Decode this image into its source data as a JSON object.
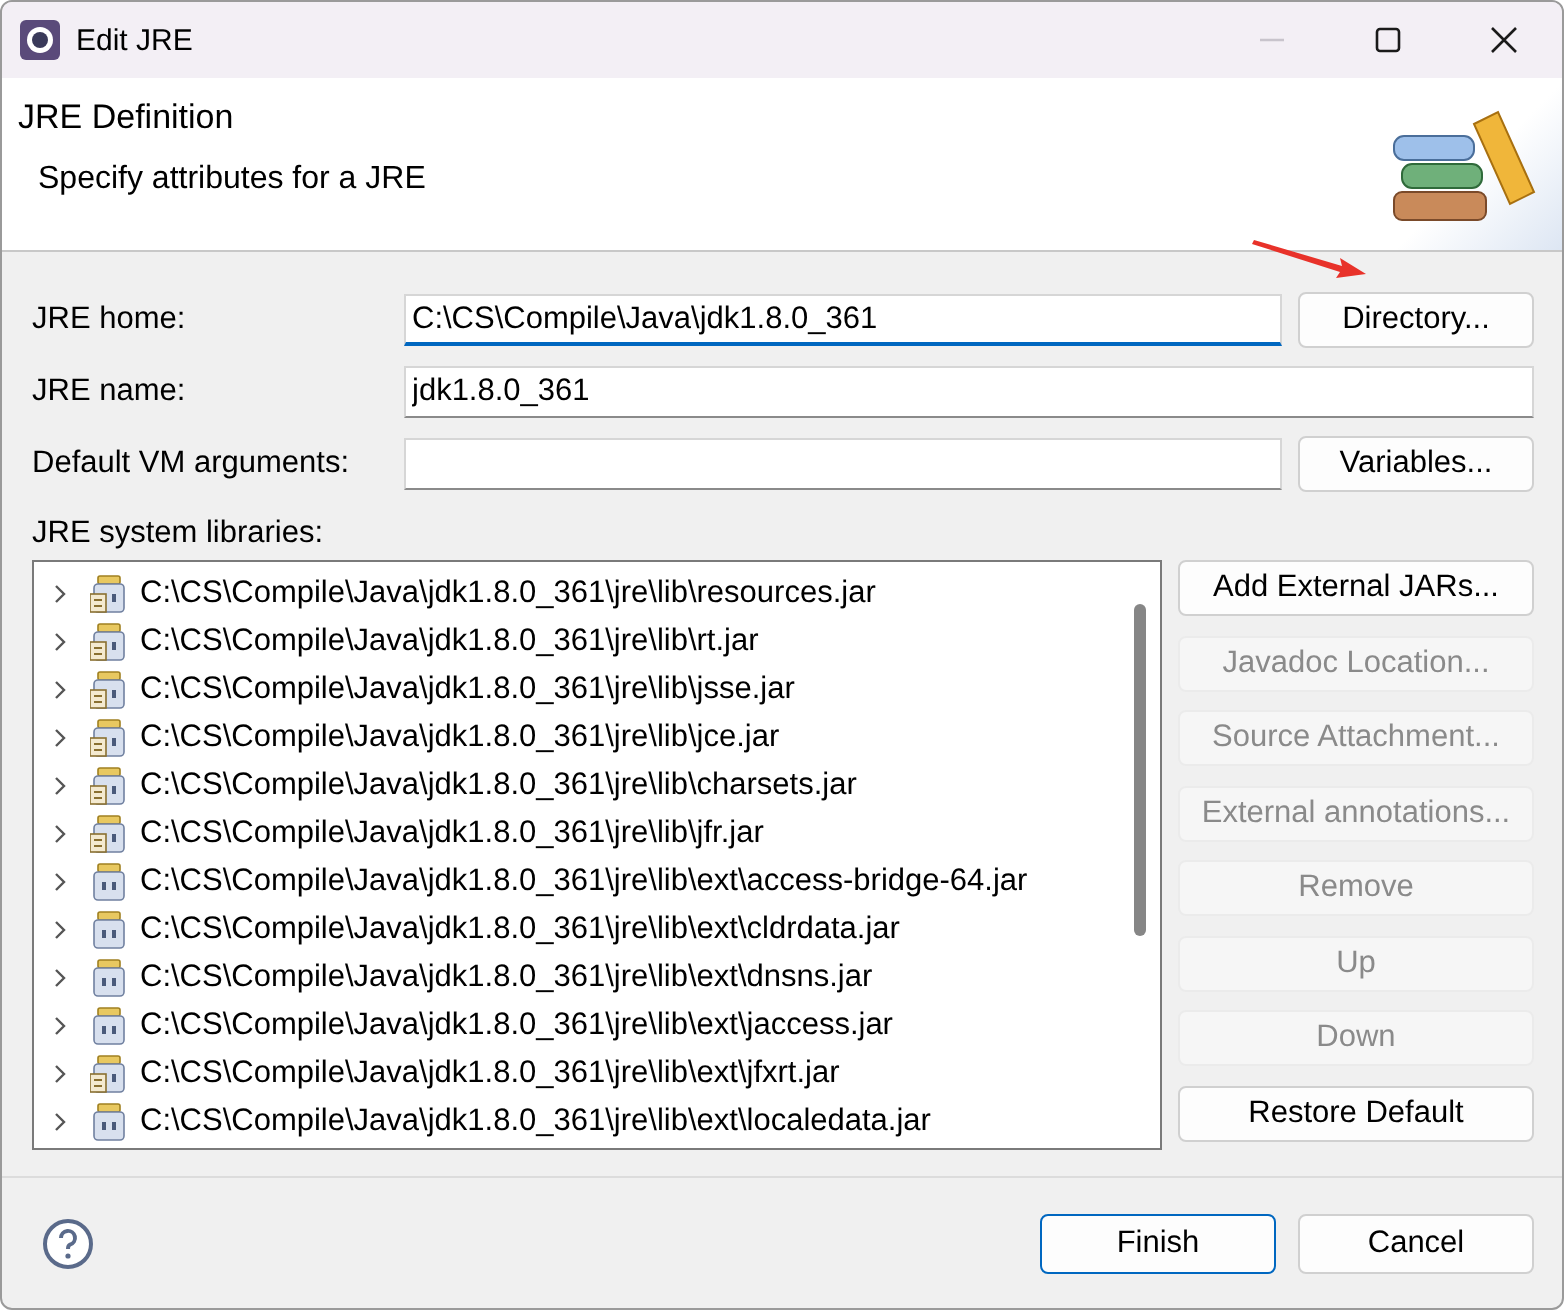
{
  "window": {
    "title": "Edit JRE",
    "controls": [
      {
        "kind": "minimize",
        "disabled": true
      },
      {
        "kind": "maximize",
        "disabled": false
      },
      {
        "kind": "close",
        "disabled": false
      }
    ]
  },
  "header": {
    "title": "JRE Definition",
    "subtitle": "Specify attributes for a JRE"
  },
  "fields": [
    {
      "label": "JRE home:",
      "value": "C:\\CS\\Compile\\Java\\jdk1.8.0_361",
      "focused": true,
      "button": "Directory..."
    },
    {
      "label": "JRE name:",
      "value": "jdk1.8.0_361",
      "focused": false
    },
    {
      "label": "Default VM arguments:",
      "focused": false,
      "button": "Variables..."
    }
  ],
  "libraries": {
    "label": "JRE system libraries:",
    "items": [
      {
        "path": "C:\\CS\\Compile\\Java\\jdk1.8.0_361\\jre\\lib\\resources.jar",
        "kind": "jar-doc",
        "expanded": false
      },
      {
        "path": "C:\\CS\\Compile\\Java\\jdk1.8.0_361\\jre\\lib\\rt.jar",
        "kind": "jar-doc",
        "expanded": false
      },
      {
        "path": "C:\\CS\\Compile\\Java\\jdk1.8.0_361\\jre\\lib\\jsse.jar",
        "kind": "jar-doc",
        "expanded": false
      },
      {
        "path": "C:\\CS\\Compile\\Java\\jdk1.8.0_361\\jre\\lib\\jce.jar",
        "kind": "jar-doc",
        "expanded": false
      },
      {
        "path": "C:\\CS\\Compile\\Java\\jdk1.8.0_361\\jre\\lib\\charsets.jar",
        "kind": "jar-doc",
        "expanded": false
      },
      {
        "path": "C:\\CS\\Compile\\Java\\jdk1.8.0_361\\jre\\lib\\jfr.jar",
        "kind": "jar-doc",
        "expanded": false
      },
      {
        "path": "C:\\CS\\Compile\\Java\\jdk1.8.0_361\\jre\\lib\\ext\\access-bridge-64.jar",
        "kind": "jar",
        "expanded": false
      },
      {
        "path": "C:\\CS\\Compile\\Java\\jdk1.8.0_361\\jre\\lib\\ext\\cldrdata.jar",
        "kind": "jar",
        "expanded": false
      },
      {
        "path": "C:\\CS\\Compile\\Java\\jdk1.8.0_361\\jre\\lib\\ext\\dnsns.jar",
        "kind": "jar",
        "expanded": false
      },
      {
        "path": "C:\\CS\\Compile\\Java\\jdk1.8.0_361\\jre\\lib\\ext\\jaccess.jar",
        "kind": "jar",
        "expanded": false
      },
      {
        "path": "C:\\CS\\Compile\\Java\\jdk1.8.0_361\\jre\\lib\\ext\\jfxrt.jar",
        "kind": "jar-doc",
        "expanded": false
      },
      {
        "path": "C:\\CS\\Compile\\Java\\jdk1.8.0_361\\jre\\lib\\ext\\localedata.jar",
        "kind": "jar",
        "expanded": false
      }
    ],
    "buttons": [
      {
        "label": "Add External JARs...",
        "disabled": false
      },
      {
        "label": "Javadoc Location...",
        "disabled": true
      },
      {
        "label": "Source Attachment...",
        "disabled": true
      },
      {
        "label": "External annotations...",
        "disabled": true
      },
      {
        "label": "Remove",
        "disabled": true
      },
      {
        "label": "Up",
        "disabled": true
      },
      {
        "label": "Down",
        "disabled": true
      },
      {
        "label": "Restore Default",
        "disabled": false
      }
    ]
  },
  "footer": {
    "buttons": [
      {
        "label": "Finish",
        "default": true
      },
      {
        "label": "Cancel",
        "default": false
      }
    ]
  }
}
